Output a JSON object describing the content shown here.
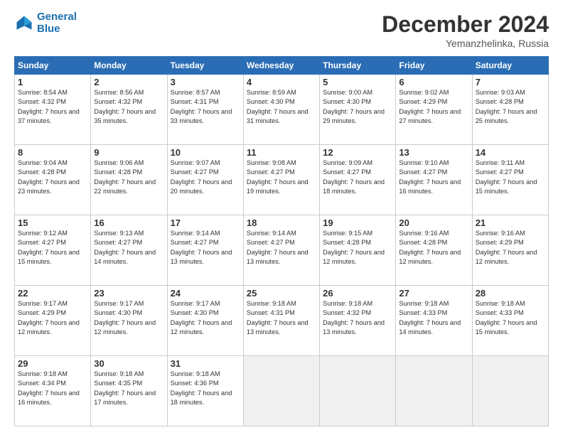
{
  "header": {
    "logo_line1": "General",
    "logo_line2": "Blue",
    "month_title": "December 2024",
    "location": "Yemanzhelinka, Russia"
  },
  "weekdays": [
    "Sunday",
    "Monday",
    "Tuesday",
    "Wednesday",
    "Thursday",
    "Friday",
    "Saturday"
  ],
  "weeks": [
    [
      {
        "day": "1",
        "sunrise": "Sunrise: 8:54 AM",
        "sunset": "Sunset: 4:32 PM",
        "daylight": "Daylight: 7 hours and 37 minutes."
      },
      {
        "day": "2",
        "sunrise": "Sunrise: 8:56 AM",
        "sunset": "Sunset: 4:32 PM",
        "daylight": "Daylight: 7 hours and 35 minutes."
      },
      {
        "day": "3",
        "sunrise": "Sunrise: 8:57 AM",
        "sunset": "Sunset: 4:31 PM",
        "daylight": "Daylight: 7 hours and 33 minutes."
      },
      {
        "day": "4",
        "sunrise": "Sunrise: 8:59 AM",
        "sunset": "Sunset: 4:30 PM",
        "daylight": "Daylight: 7 hours and 31 minutes."
      },
      {
        "day": "5",
        "sunrise": "Sunrise: 9:00 AM",
        "sunset": "Sunset: 4:30 PM",
        "daylight": "Daylight: 7 hours and 29 minutes."
      },
      {
        "day": "6",
        "sunrise": "Sunrise: 9:02 AM",
        "sunset": "Sunset: 4:29 PM",
        "daylight": "Daylight: 7 hours and 27 minutes."
      },
      {
        "day": "7",
        "sunrise": "Sunrise: 9:03 AM",
        "sunset": "Sunset: 4:28 PM",
        "daylight": "Daylight: 7 hours and 25 minutes."
      }
    ],
    [
      {
        "day": "8",
        "sunrise": "Sunrise: 9:04 AM",
        "sunset": "Sunset: 4:28 PM",
        "daylight": "Daylight: 7 hours and 23 minutes."
      },
      {
        "day": "9",
        "sunrise": "Sunrise: 9:06 AM",
        "sunset": "Sunset: 4:28 PM",
        "daylight": "Daylight: 7 hours and 22 minutes."
      },
      {
        "day": "10",
        "sunrise": "Sunrise: 9:07 AM",
        "sunset": "Sunset: 4:27 PM",
        "daylight": "Daylight: 7 hours and 20 minutes."
      },
      {
        "day": "11",
        "sunrise": "Sunrise: 9:08 AM",
        "sunset": "Sunset: 4:27 PM",
        "daylight": "Daylight: 7 hours and 19 minutes."
      },
      {
        "day": "12",
        "sunrise": "Sunrise: 9:09 AM",
        "sunset": "Sunset: 4:27 PM",
        "daylight": "Daylight: 7 hours and 18 minutes."
      },
      {
        "day": "13",
        "sunrise": "Sunrise: 9:10 AM",
        "sunset": "Sunset: 4:27 PM",
        "daylight": "Daylight: 7 hours and 16 minutes."
      },
      {
        "day": "14",
        "sunrise": "Sunrise: 9:11 AM",
        "sunset": "Sunset: 4:27 PM",
        "daylight": "Daylight: 7 hours and 15 minutes."
      }
    ],
    [
      {
        "day": "15",
        "sunrise": "Sunrise: 9:12 AM",
        "sunset": "Sunset: 4:27 PM",
        "daylight": "Daylight: 7 hours and 15 minutes."
      },
      {
        "day": "16",
        "sunrise": "Sunrise: 9:13 AM",
        "sunset": "Sunset: 4:27 PM",
        "daylight": "Daylight: 7 hours and 14 minutes."
      },
      {
        "day": "17",
        "sunrise": "Sunrise: 9:14 AM",
        "sunset": "Sunset: 4:27 PM",
        "daylight": "Daylight: 7 hours and 13 minutes."
      },
      {
        "day": "18",
        "sunrise": "Sunrise: 9:14 AM",
        "sunset": "Sunset: 4:27 PM",
        "daylight": "Daylight: 7 hours and 13 minutes."
      },
      {
        "day": "19",
        "sunrise": "Sunrise: 9:15 AM",
        "sunset": "Sunset: 4:28 PM",
        "daylight": "Daylight: 7 hours and 12 minutes."
      },
      {
        "day": "20",
        "sunrise": "Sunrise: 9:16 AM",
        "sunset": "Sunset: 4:28 PM",
        "daylight": "Daylight: 7 hours and 12 minutes."
      },
      {
        "day": "21",
        "sunrise": "Sunrise: 9:16 AM",
        "sunset": "Sunset: 4:29 PM",
        "daylight": "Daylight: 7 hours and 12 minutes."
      }
    ],
    [
      {
        "day": "22",
        "sunrise": "Sunrise: 9:17 AM",
        "sunset": "Sunset: 4:29 PM",
        "daylight": "Daylight: 7 hours and 12 minutes."
      },
      {
        "day": "23",
        "sunrise": "Sunrise: 9:17 AM",
        "sunset": "Sunset: 4:30 PM",
        "daylight": "Daylight: 7 hours and 12 minutes."
      },
      {
        "day": "24",
        "sunrise": "Sunrise: 9:17 AM",
        "sunset": "Sunset: 4:30 PM",
        "daylight": "Daylight: 7 hours and 12 minutes."
      },
      {
        "day": "25",
        "sunrise": "Sunrise: 9:18 AM",
        "sunset": "Sunset: 4:31 PM",
        "daylight": "Daylight: 7 hours and 13 minutes."
      },
      {
        "day": "26",
        "sunrise": "Sunrise: 9:18 AM",
        "sunset": "Sunset: 4:32 PM",
        "daylight": "Daylight: 7 hours and 13 minutes."
      },
      {
        "day": "27",
        "sunrise": "Sunrise: 9:18 AM",
        "sunset": "Sunset: 4:33 PM",
        "daylight": "Daylight: 7 hours and 14 minutes."
      },
      {
        "day": "28",
        "sunrise": "Sunrise: 9:18 AM",
        "sunset": "Sunset: 4:33 PM",
        "daylight": "Daylight: 7 hours and 15 minutes."
      }
    ],
    [
      {
        "day": "29",
        "sunrise": "Sunrise: 9:18 AM",
        "sunset": "Sunset: 4:34 PM",
        "daylight": "Daylight: 7 hours and 16 minutes."
      },
      {
        "day": "30",
        "sunrise": "Sunrise: 9:18 AM",
        "sunset": "Sunset: 4:35 PM",
        "daylight": "Daylight: 7 hours and 17 minutes."
      },
      {
        "day": "31",
        "sunrise": "Sunrise: 9:18 AM",
        "sunset": "Sunset: 4:36 PM",
        "daylight": "Daylight: 7 hours and 18 minutes."
      },
      null,
      null,
      null,
      null
    ]
  ]
}
